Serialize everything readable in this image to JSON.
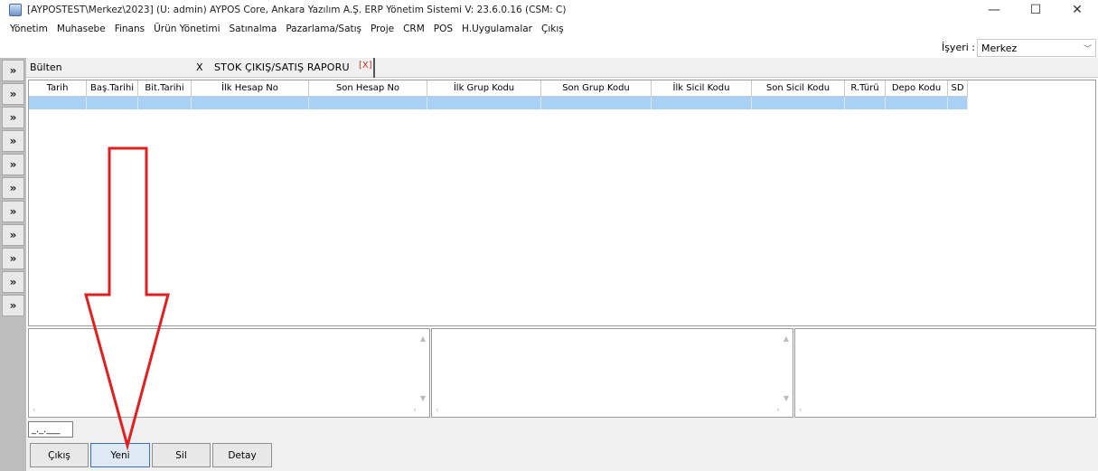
{
  "window": {
    "title": "[AYPOSTEST\\Merkez\\2023] (U: admin) AYPOS Core, Ankara Yazılım A.Ş. ERP Yönetim Sistemi V: 23.6.0.16 (CSM: C)",
    "minimize": "—",
    "maximize": "☐",
    "close": "✕"
  },
  "menu": [
    "Yönetim",
    "Muhasebe",
    "Finans",
    "Ürün Yönetimi",
    "Satınalma",
    "Pazarlama/Satış",
    "Proje",
    "CRM",
    "POS",
    "H.Uygulamalar",
    "Çıkış"
  ],
  "workplace": {
    "label": "İşyeri :",
    "value": "Merkez"
  },
  "sidebar": {
    "toggle_glyph": "»"
  },
  "tabs": {
    "bulletin": "Bülten",
    "close_mark": "X",
    "report_title": "STOK ÇIKIŞ/SATIŞ RAPORU",
    "close_button": "[X]"
  },
  "grid": {
    "columns": [
      "Tarih",
      "Baş.Tarihi",
      "Bit.Tarihi",
      "İlk Hesap No",
      "Son Hesap No",
      "İlk Grup Kodu",
      "Son Grup Kodu",
      "İlk Sicil Kodu",
      "Son Sicil Kodu",
      "R.Türü",
      "Depo Kodu",
      "SD"
    ]
  },
  "date_field": {
    "value": "_._.___"
  },
  "buttons": {
    "exit": "Çıkış",
    "new": "Yeni",
    "delete": "Sil",
    "detail": "Detay"
  },
  "colors": {
    "selected_row": "#a9d1f5",
    "annotation_arrow": "#e02020",
    "sidebar": "#bdbdbd"
  }
}
